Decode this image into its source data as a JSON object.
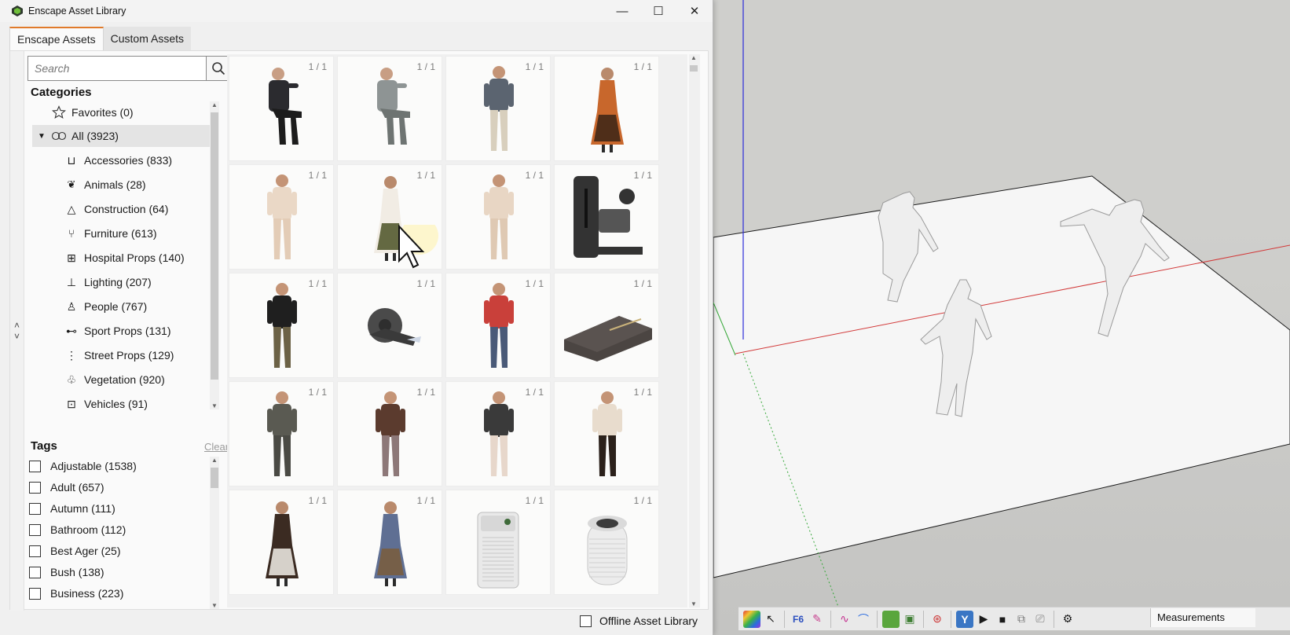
{
  "window": {
    "title": "Enscape Asset Library",
    "controls": {
      "minimize": "—",
      "maximize": "☐",
      "close": "✕"
    }
  },
  "tabs": [
    {
      "label": "Enscape Assets",
      "active": true
    },
    {
      "label": "Custom Assets",
      "active": false
    }
  ],
  "search": {
    "placeholder": "Search",
    "value": "",
    "icon": "search-icon"
  },
  "categories": {
    "title": "Categories",
    "favorites": {
      "label": "Favorites (0)",
      "icon": "star-icon"
    },
    "all": {
      "label": "All (3923)",
      "icon": "all-assets-icon",
      "expanded": true,
      "selected": true
    },
    "items": [
      {
        "label": "Accessories (833)",
        "icon": "accessories-icon"
      },
      {
        "label": "Animals (28)",
        "icon": "paw-icon"
      },
      {
        "label": "Construction (64)",
        "icon": "traffic-cone-icon"
      },
      {
        "label": "Furniture (613)",
        "icon": "chair-icon"
      },
      {
        "label": "Hospital Props (140)",
        "icon": "medical-bag-icon"
      },
      {
        "label": "Lighting (207)",
        "icon": "lamp-icon"
      },
      {
        "label": "People (767)",
        "icon": "person-icon"
      },
      {
        "label": "Sport Props (131)",
        "icon": "dumbbell-icon"
      },
      {
        "label": "Street Props (129)",
        "icon": "traffic-light-icon"
      },
      {
        "label": "Vegetation (920)",
        "icon": "tree-icon"
      },
      {
        "label": "Vehicles (91)",
        "icon": "car-icon"
      }
    ]
  },
  "tags": {
    "title": "Tags",
    "clear_label": "Clear",
    "items": [
      {
        "label": "Adjustable (1538)",
        "checked": false
      },
      {
        "label": "Adult (657)",
        "checked": false
      },
      {
        "label": "Autumn (111)",
        "checked": false
      },
      {
        "label": "Bathroom (112)",
        "checked": false
      },
      {
        "label": "Best Ager (25)",
        "checked": false
      },
      {
        "label": "Bush (138)",
        "checked": false
      },
      {
        "label": "Business (223)",
        "checked": false
      }
    ]
  },
  "assets": [
    {
      "kind": "person-sitting-dark-suit",
      "count": "1 / 1",
      "colors": [
        "#2b2b2f",
        "#1c1c1c"
      ]
    },
    {
      "kind": "person-sitting-grey-suit",
      "count": "1 / 1",
      "colors": [
        "#8e9494",
        "#6e7472"
      ]
    },
    {
      "kind": "person-phone-striped",
      "count": "1 / 1",
      "colors": [
        "#5b6470",
        "#d8cfbd"
      ]
    },
    {
      "kind": "person-floral-dress",
      "count": "1 / 1",
      "colors": [
        "#c8672c",
        "#3a2416"
      ]
    },
    {
      "kind": "person-cream-suit",
      "count": "1 / 1",
      "colors": [
        "#ead8c6",
        "#e3ccb6"
      ]
    },
    {
      "kind": "person-tablet-apron",
      "count": "1 / 1",
      "colors": [
        "#f1ece4",
        "#4b5226"
      ]
    },
    {
      "kind": "person-cream-suit-bag",
      "count": "1 / 1",
      "colors": [
        "#e8d6c4",
        "#dfc9b3"
      ]
    },
    {
      "kind": "gym-machine",
      "count": "1 / 1",
      "colors": [
        "#333333",
        "#555555"
      ]
    },
    {
      "kind": "person-black-sweater",
      "count": "1 / 1",
      "colors": [
        "#1f1f1f",
        "#6c6246"
      ]
    },
    {
      "kind": "tape-dispenser",
      "count": "1 / 1",
      "colors": [
        "#4a4a4a",
        "#cfd8e6"
      ]
    },
    {
      "kind": "person-red-jacket",
      "count": "1 / 1",
      "colors": [
        "#c9403a",
        "#4a5a78"
      ]
    },
    {
      "kind": "step-platform",
      "count": "1 / 1",
      "colors": [
        "#4b4542",
        "#c9b27a"
      ]
    },
    {
      "kind": "person-grey-outfit",
      "count": "1 / 1",
      "colors": [
        "#5a5a52",
        "#4a4a44"
      ]
    },
    {
      "kind": "person-brown-jacket",
      "count": "1 / 1",
      "colors": [
        "#5b3b2e",
        "#8d7878"
      ]
    },
    {
      "kind": "person-waving-dark",
      "count": "1 / 1",
      "colors": [
        "#3a3a3a",
        "#e7d7cb"
      ]
    },
    {
      "kind": "person-beige-cardigan",
      "count": "1 / 1",
      "colors": [
        "#e8dccd",
        "#2b211b"
      ]
    },
    {
      "kind": "person-waiter-tray",
      "count": "1 / 1",
      "colors": [
        "#3b2b22",
        "#f2eee8"
      ]
    },
    {
      "kind": "person-patterned-dress",
      "count": "1 / 1",
      "colors": [
        "#5f6f93",
        "#7a5d3b"
      ]
    },
    {
      "kind": "air-purifier-square",
      "count": "1 / 1",
      "colors": [
        "#e9e9e9",
        "#3f6b3a"
      ]
    },
    {
      "kind": "air-purifier-round",
      "count": "1 / 1",
      "colors": [
        "#ececec",
        "#3b3b3b"
      ]
    }
  ],
  "offline": {
    "label": "Offline Asset Library",
    "checked": false
  },
  "toolbar": {
    "measurements_label": "Measurements",
    "icons": [
      "color-palette-icon",
      "select-cursor-icon",
      "fredo-tools-icon",
      "paint-icon",
      "curve-tool-icon",
      "arc-tool-icon",
      "terrain-icon",
      "camera-icon",
      "compass-icon",
      "y-tool-icon",
      "play-icon",
      "stop-icon",
      "record-icon",
      "video-icon",
      "settings-icon"
    ]
  }
}
